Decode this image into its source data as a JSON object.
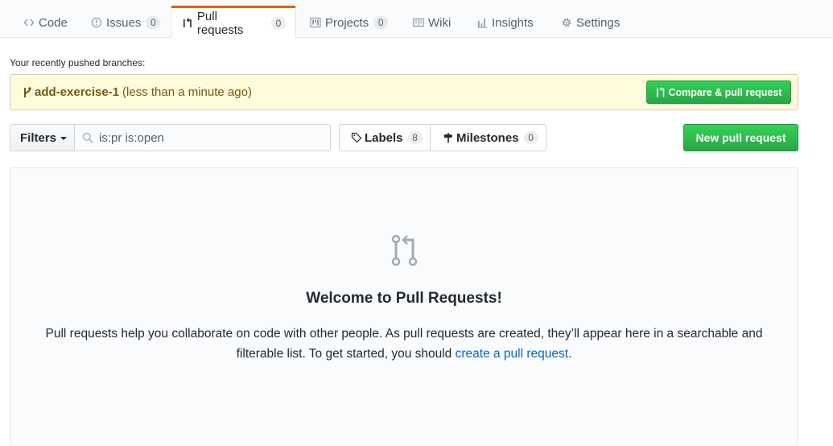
{
  "tabs": {
    "code": {
      "label": "Code",
      "icon": "code-icon"
    },
    "issues": {
      "label": "Issues",
      "count": "0",
      "icon": "issue-icon"
    },
    "pulls": {
      "label": "Pull requests",
      "count": "0",
      "icon": "pull-request-icon",
      "selected": true
    },
    "projects": {
      "label": "Projects",
      "count": "0",
      "icon": "project-icon"
    },
    "wiki": {
      "label": "Wiki",
      "icon": "book-icon"
    },
    "insights": {
      "label": "Insights",
      "icon": "graph-icon"
    },
    "settings": {
      "label": "Settings",
      "icon": "gear-icon"
    }
  },
  "recent": {
    "label": "Your recently pushed branches:",
    "branch": "add-exercise-1",
    "time": "(less than a minute ago)",
    "compare_label": "Compare & pull request"
  },
  "filters": {
    "filters_label": "Filters",
    "search_value": "is:pr is:open",
    "labels_label": "Labels",
    "labels_count": "8",
    "milestones_label": "Milestones",
    "milestones_count": "0",
    "new_pr_label": "New pull request"
  },
  "blankslate": {
    "title": "Welcome to Pull Requests!",
    "text_before": "Pull requests help you collaborate on code with other people. As pull requests are created, they’ll appear here in a searchable and filterable list. To get started, you should ",
    "link_text": "create a pull request",
    "text_after": "."
  },
  "colors": {
    "accent_tab": "#e36209",
    "primary_green": "#28a745",
    "link_blue": "#0366d6",
    "notice_bg": "#fffbdd"
  }
}
